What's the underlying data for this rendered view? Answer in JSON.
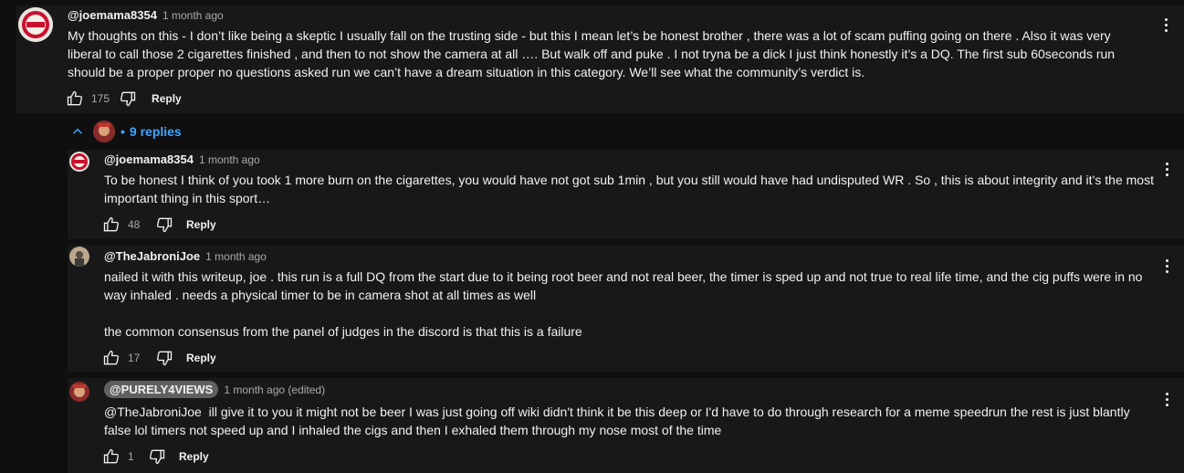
{
  "comments": [
    {
      "author": "@joemama8354",
      "time": "1 month ago",
      "text": "My thoughts on this - I don’t like being a skeptic I usually fall on the trusting side - but this I mean let’s be honest brother , there was a lot of scam puffing going on there . Also it was very liberal to call those 2 cigarettes finished , and then to not show the camera at all …. But walk off and puke . I not tryna be a dick I just think honestly it’s a DQ. The first sub 60seconds run should be a proper proper no questions asked run we can’t have a dream situation in this category. We’ll see what the community’s verdict is.",
      "likes": "175",
      "reply_label": "Reply"
    }
  ],
  "replies_toggle": {
    "label": "9 replies",
    "dot": "•"
  },
  "replies": [
    {
      "author": "@joemama8354",
      "time": "1 month ago",
      "text": "To be honest I think of you took 1 more burn on the cigarettes, you would have not got sub 1min , but you still would have had undisputed WR . So , this is about integrity and it’s the most important thing in this sport…",
      "likes": "48",
      "reply_label": "Reply"
    },
    {
      "author": "@TheJabroniJoe",
      "time": "1 month ago",
      "text_p1": "nailed it with this writeup, joe . this run is a full DQ from the start due to it being root beer and not real beer, the timer is sped up and not true to real life time, and the cig puffs were in no way inhaled . needs a physical timer to be in camera shot at all times as well",
      "text_p2": "the common consensus from the panel of judges in the discord is that this is a failure",
      "likes": "17",
      "reply_label": "Reply"
    },
    {
      "author": "@PURELY4VIEWS",
      "time": "1 month ago (edited)",
      "mention": "@TheJabroniJoe",
      "text": "ill give it to you it might not be beer I was just going off wiki didn't think it be this deep or I'd have to do through research for a meme speedrun the rest is just blantly false lol timers not speed up and I inhaled the cigs and then I exhaled them through my nose most of the time",
      "likes": "1",
      "reply_label": "Reply"
    }
  ],
  "icons": {
    "like": "thumbs-up-icon",
    "dislike": "thumbs-down-icon",
    "menu": "more-vert-icon",
    "collapse": "chevron-up-icon"
  },
  "colors": {
    "background": "#0f0f0f",
    "card": "#181818",
    "link": "#3ea6ff",
    "muted": "#aaaaaa",
    "chip": "#606060"
  }
}
